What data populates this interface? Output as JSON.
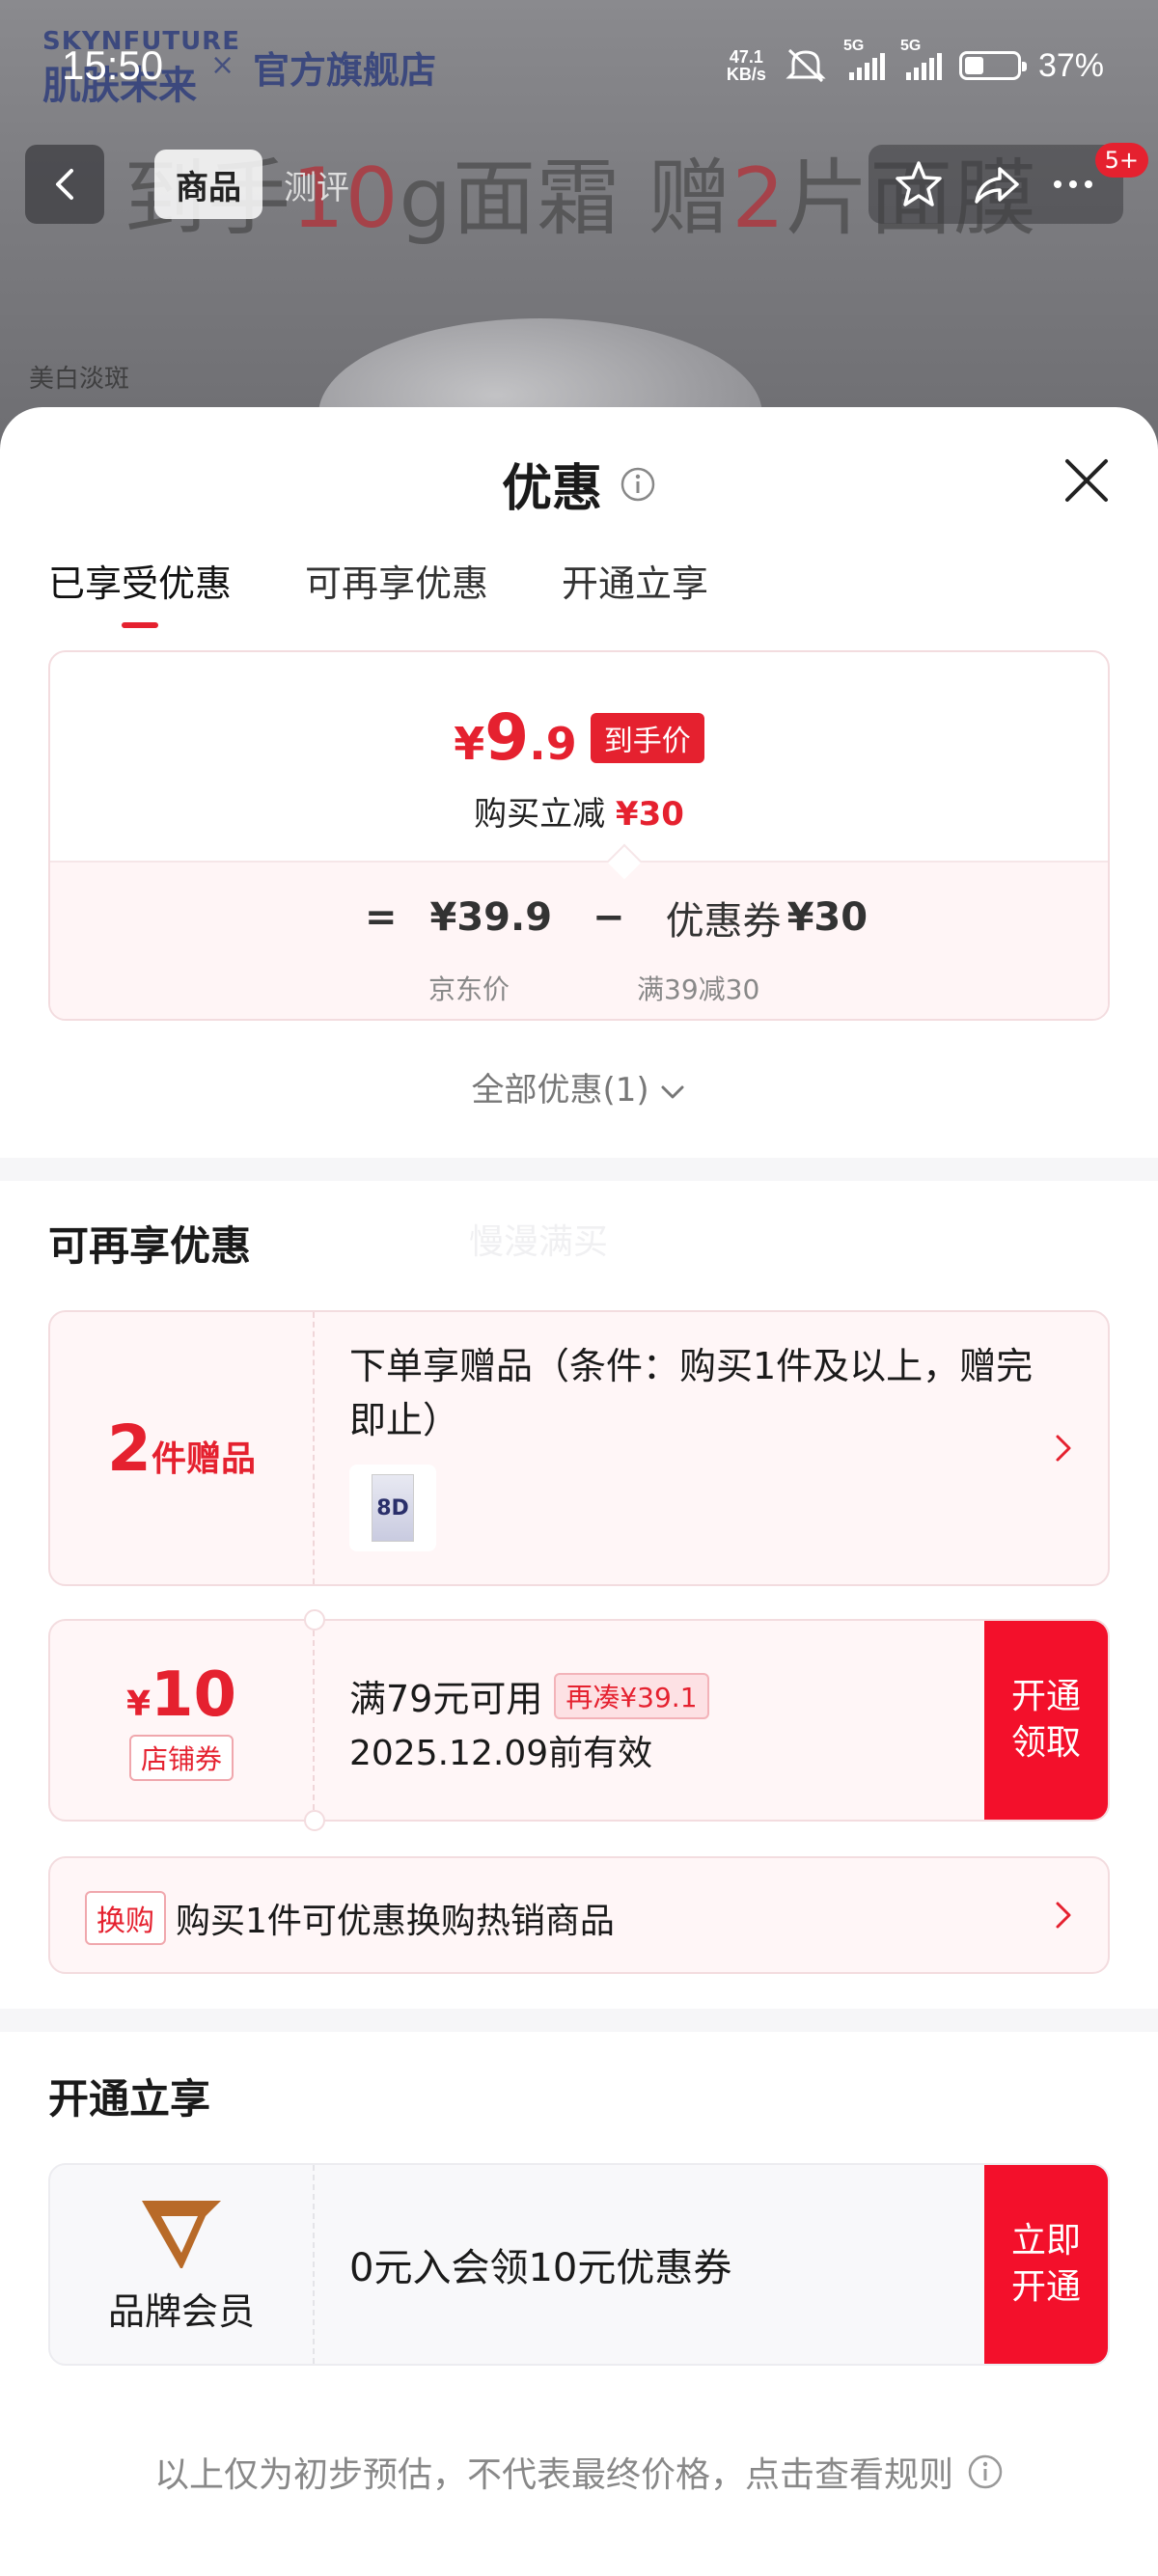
{
  "status_bar": {
    "time": "15:50",
    "net_speed_value": "47.1",
    "net_speed_unit": "KB/s",
    "signal_1": "5G",
    "signal_2": "5G",
    "battery": "37%",
    "battery_level": 0.37
  },
  "background": {
    "brand_line1": "SKYNFUTURE",
    "brand_line2": "肌肤未来",
    "x_mark": "×",
    "flagship": "官方旗舰店",
    "headline_a": "到手",
    "headline_num1": "10",
    "headline_b": "g面霜 赠",
    "headline_num2": "2",
    "headline_c": "片面膜",
    "tag": "美白淡斑",
    "nav_tabs": [
      "商品",
      "测评"
    ],
    "badge_count": "5+"
  },
  "sheet": {
    "title": "优惠",
    "tabs": [
      "已享受优惠",
      "可再享优惠",
      "开通立享"
    ],
    "price_card": {
      "currency": "¥",
      "final_int": "9",
      "final_dec": ".9",
      "to_hand_label": "到手价",
      "instant_label": "购买立减",
      "instant_amount": "¥30",
      "equals": "=",
      "jd_price": "¥39.9",
      "minus": "−",
      "coupon_label": "优惠券",
      "coupon_amount": "¥30",
      "jd_price_label": "京东价",
      "coupon_rule": "满39减30"
    },
    "all_discount": "全部优惠(1)",
    "section_more": "可再享优惠",
    "watermark": "慢漫满买",
    "gift": {
      "count": "2",
      "unit_label": "件赠品",
      "text": "下单享赠品（条件：购买1件及以上，赠完即止）",
      "thumb_text": "8D"
    },
    "coupon": {
      "currency": "¥",
      "amount": "10",
      "tag": "店铺券",
      "condition": "满79元可用",
      "pill": "再凑¥39.1",
      "validity": "2025.12.09前有效",
      "action_line1": "开通",
      "action_line2": "领取"
    },
    "swap": {
      "tag": "换购",
      "text": "购买1件可优惠换购热销商品"
    },
    "section_open": "开通立享",
    "member": {
      "label": "品牌会员",
      "text": "0元入会领10元优惠券",
      "action_line1": "立即",
      "action_line2": "开通"
    },
    "footer_note": "以上仅为初步预估，不代表最终价格，点击查看规则"
  },
  "colors": {
    "accent_red": "#e5212f",
    "action_red": "#f3102b",
    "card_bg": "#fff6f7",
    "brand_gold": "#b86a28"
  }
}
